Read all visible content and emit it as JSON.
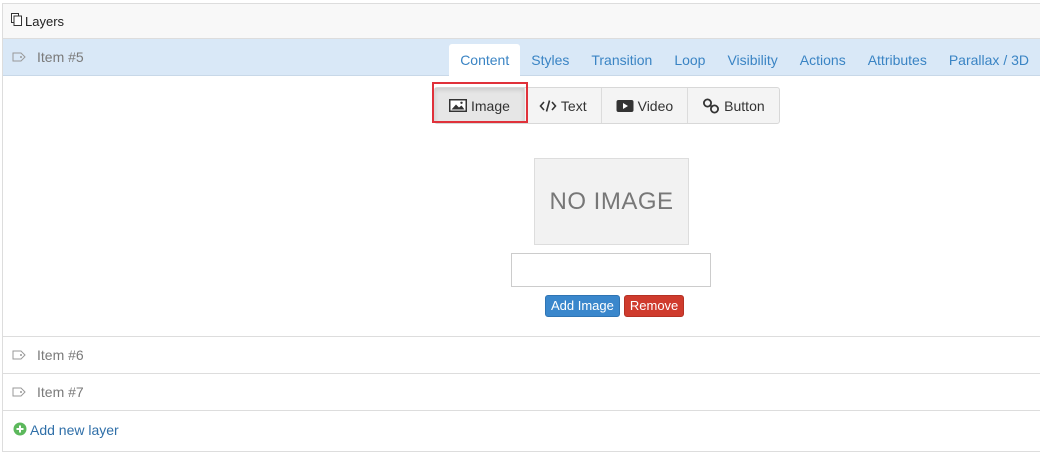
{
  "header": {
    "title": "Layers",
    "icon": "layers-icon"
  },
  "items": [
    {
      "label": "Item #5",
      "active": true
    },
    {
      "label": "Item #6",
      "active": false
    },
    {
      "label": "Item #7",
      "active": false
    }
  ],
  "tabs": [
    {
      "label": "Content",
      "active": true
    },
    {
      "label": "Styles"
    },
    {
      "label": "Transition"
    },
    {
      "label": "Loop"
    },
    {
      "label": "Visibility"
    },
    {
      "label": "Actions"
    },
    {
      "label": "Attributes"
    },
    {
      "label": "Parallax / 3D"
    }
  ],
  "content_types": [
    {
      "label": "Image",
      "icon": "image-icon",
      "selected": true
    },
    {
      "label": "Text",
      "icon": "code-icon"
    },
    {
      "label": "Video",
      "icon": "video-icon"
    },
    {
      "label": "Button",
      "icon": "link-icon"
    }
  ],
  "image_panel": {
    "placeholder_text": "NO IMAGE",
    "url_value": "",
    "add_label": "Add Image",
    "remove_label": "Remove"
  },
  "footer": {
    "add_label": "Add new layer"
  },
  "colors": {
    "accent": "#3a84c4",
    "active_row": "#d9e8f7",
    "danger": "#cf3b2d",
    "add_green": "#5cb85c",
    "highlight": "#e0313a"
  }
}
